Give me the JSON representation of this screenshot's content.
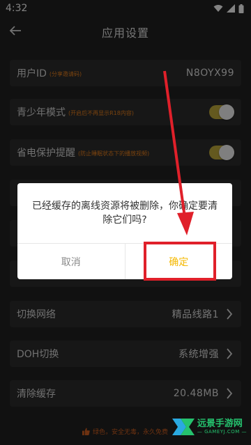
{
  "status_bar": {
    "time": "4:32",
    "icons": [
      "wifi-icon",
      "signal-icon",
      "battery-icon"
    ]
  },
  "app_bar": {
    "title": "应用设置",
    "back_icon": "arrow-left-icon"
  },
  "settings": {
    "user_id": {
      "label": "用户ID",
      "hint": "(分享邀请码)",
      "value": "N8OYX99"
    },
    "teen_mode": {
      "label": "青少年模式",
      "hint": "(开启后不再显示R18内容)",
      "enabled": true
    },
    "power_saving": {
      "label": "省电保护提醒",
      "hint": "(防止睡眠状态下的播放视频)",
      "enabled": true
    },
    "switch_network": {
      "label": "切换网络",
      "value": "精品线路1"
    },
    "doh_switch": {
      "label": "DOH切换",
      "value": "系统增强"
    },
    "clear_cache": {
      "label": "清除缓存",
      "value": "20.48MB"
    }
  },
  "dialog": {
    "message": "已经缓存的离线资源将被删除，你确定要清除它们吗?",
    "cancel_label": "取消",
    "confirm_label": "确定"
  },
  "footer": {
    "slogan": "绿色，安全无毒，永久免费"
  },
  "watermark": {
    "title": "远景手游网",
    "url": "— GAMEYJ.COM —"
  },
  "colors": {
    "accent": "#f5b800",
    "annotation_red": "#e0202a",
    "footer_orange": "#c85b1f",
    "watermark_green": "#25c26e"
  }
}
